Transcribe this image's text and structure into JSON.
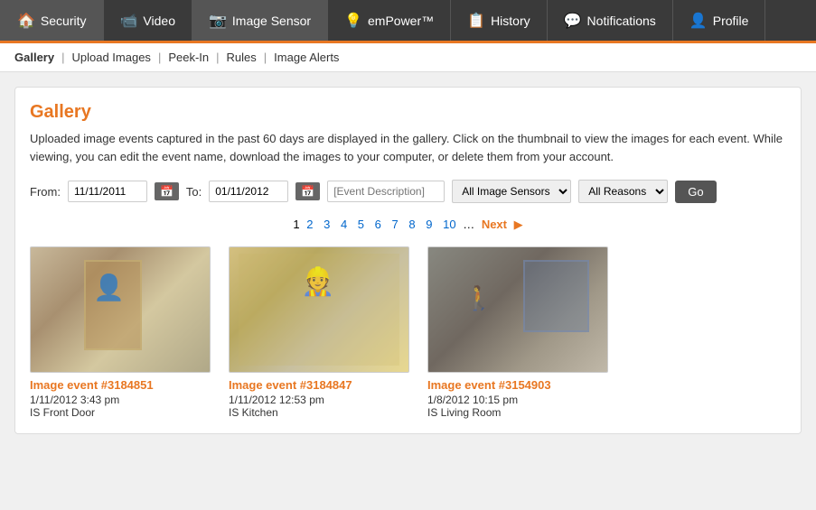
{
  "nav": {
    "items": [
      {
        "id": "security",
        "label": "Security",
        "icon": "🏠",
        "active": false
      },
      {
        "id": "video",
        "label": "Video",
        "icon": "📷",
        "active": false
      },
      {
        "id": "image-sensor",
        "label": "Image Sensor",
        "icon": "📷",
        "active": true
      },
      {
        "id": "empower",
        "label": "emPower™",
        "icon": "💡",
        "active": false
      },
      {
        "id": "history",
        "label": "History",
        "icon": "📋",
        "active": false
      },
      {
        "id": "notifications",
        "label": "Notifications",
        "icon": "💬",
        "active": false
      },
      {
        "id": "profile",
        "label": "Profile",
        "icon": "👤",
        "active": false
      }
    ]
  },
  "subnav": {
    "items": [
      {
        "id": "gallery",
        "label": "Gallery"
      },
      {
        "id": "upload-images",
        "label": "Upload Images"
      },
      {
        "id": "peek-in",
        "label": "Peek-In"
      },
      {
        "id": "rules",
        "label": "Rules"
      },
      {
        "id": "image-alerts",
        "label": "Image Alerts"
      }
    ]
  },
  "gallery": {
    "title": "Gallery",
    "description": "Uploaded image events captured in the past 60 days are displayed in the gallery. Click on the thumbnail to view the images for each event. While viewing, you can edit the event name, download the images to your computer, or delete them from your account.",
    "filter": {
      "from_label": "From:",
      "from_value": "11/11/2011",
      "to_label": "To:",
      "to_value": "01/11/2012",
      "event_description_placeholder": "[Event Description]",
      "sensors_label": "All Image Sensors",
      "reasons_label": "All Reasons",
      "go_label": "Go"
    },
    "pagination": {
      "pages": [
        "1",
        "2",
        "3",
        "4",
        "5",
        "6",
        "7",
        "8",
        "9",
        "10"
      ],
      "current": "1",
      "next_label": "Next",
      "ellipsis": "…"
    },
    "events": [
      {
        "id": "evt-1",
        "title": "Image event #3184851",
        "date": "1/11/2012 3:43 pm",
        "location": "IS Front Door",
        "thumb_class": "thumb-1"
      },
      {
        "id": "evt-2",
        "title": "Image event #3184847",
        "date": "1/11/2012 12:53 pm",
        "location": "IS Kitchen",
        "thumb_class": "thumb-2"
      },
      {
        "id": "evt-3",
        "title": "Image event #3154903",
        "date": "1/8/2012 10:15 pm",
        "location": "IS Living Room",
        "thumb_class": "thumb-3"
      }
    ]
  }
}
